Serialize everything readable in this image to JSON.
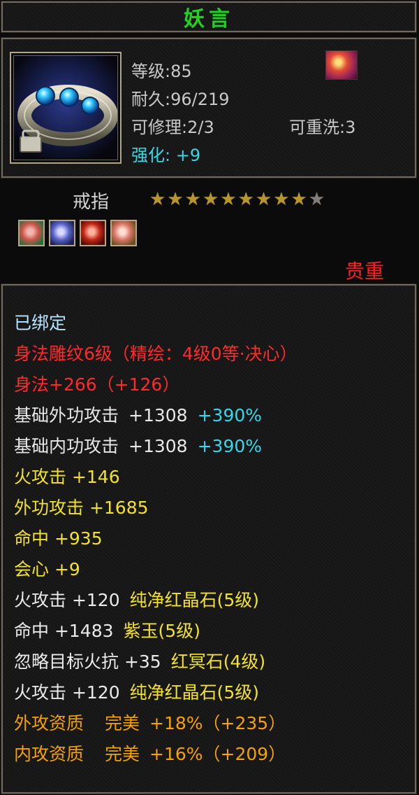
{
  "title": "妖言",
  "info": {
    "level": "等级:85",
    "durability": "耐久:96/219",
    "repairable": "可修理:2/3",
    "rewash": "可重洗:3",
    "enhance_label": "强化:",
    "enhance_value": "+9"
  },
  "item": {
    "name": "戒指",
    "stars_filled": 9,
    "stars_total": 10,
    "quality": "贵重"
  },
  "attributes": {
    "bound": "已绑定",
    "carving": "身法雕纹6级（精绘：4级0等·决心）",
    "agility": "身法+266（+126）",
    "base_ext_attack": {
      "label": "基础外功攻击",
      "value": "+1308",
      "percent": "+390%"
    },
    "base_int_attack": {
      "label": "基础内功攻击",
      "value": "+1308",
      "percent": "+390%"
    },
    "fire_attack": "火攻击 +146",
    "ext_attack": "外功攻击 +1685",
    "hit": "命中 +935",
    "crit": "会心 +9",
    "gem1": {
      "stat": "火攻击 +120",
      "gem": "纯净红晶石(5级)"
    },
    "gem2": {
      "stat": "命中 +1483",
      "gem": "紫玉(5级)"
    },
    "gem3": {
      "stat": "忽略目标火抗 +35",
      "gem": "红冥石(4级)"
    },
    "gem4": {
      "stat": "火攻击 +120",
      "gem": "纯净红晶石(5级)"
    },
    "ext_quality": {
      "label": "外攻资质",
      "grade": "完美",
      "value": "+18%（+235）"
    },
    "int_quality": {
      "label": "内攻资质",
      "grade": "完美",
      "value": "+16%（+209）"
    }
  },
  "icons": {
    "item_icon": "ring-icon",
    "skill_icon": "fire-skill-icon",
    "socket_icons": [
      "red-gem-icon",
      "purple-gem-icon",
      "red-stone-icon",
      "red-gem-icon"
    ]
  },
  "colors": {
    "title": "#21d321",
    "quality": "#ff2020",
    "enhance": "#34d9e6",
    "carving": "#ff2a2a",
    "attribute": "#f3e22b",
    "qualification": "#f7a200"
  }
}
